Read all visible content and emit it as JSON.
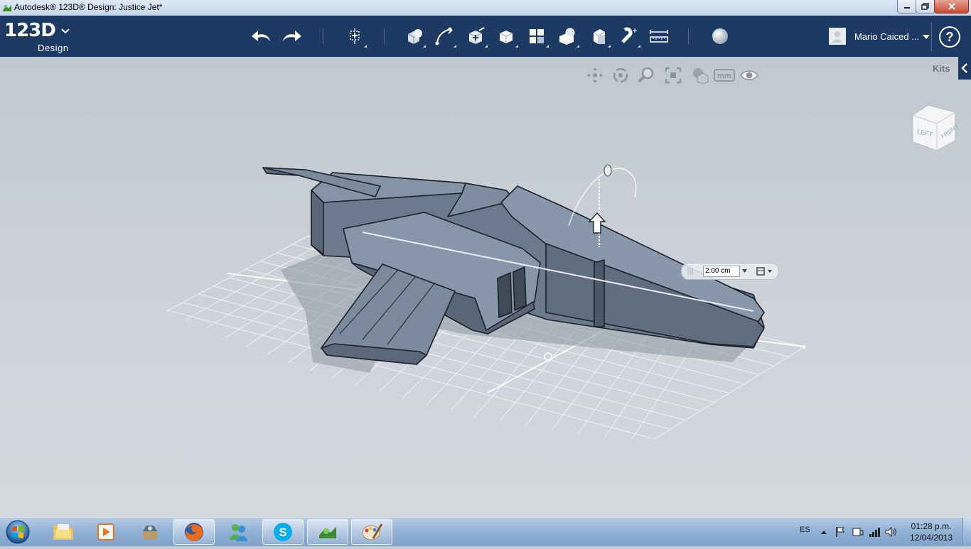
{
  "window": {
    "title": "Autodesk® 123D® Design: Justice Jet*",
    "minimize_icon": "minimize-icon",
    "maximize_icon": "maximize-icon",
    "close_icon": "close-icon"
  },
  "appbar": {
    "logo_main": "123D",
    "logo_sub": "Design",
    "logo_menu_icon": "chevron-down-icon",
    "toolbar": [
      {
        "name": "undo-button",
        "icon": "undo-icon"
      },
      {
        "name": "redo-button",
        "icon": "redo-icon"
      },
      {
        "name": "transform-button",
        "icon": "transform-icon"
      },
      {
        "name": "primitives-button",
        "icon": "primitives-icon"
      },
      {
        "name": "sketch-button",
        "icon": "sketch-icon"
      },
      {
        "name": "construct-button",
        "icon": "construct-icon"
      },
      {
        "name": "modify-button",
        "icon": "modify-icon"
      },
      {
        "name": "pattern-button",
        "icon": "pattern-icon"
      },
      {
        "name": "group-button",
        "icon": "group-icon"
      },
      {
        "name": "combine-button",
        "icon": "combine-icon"
      },
      {
        "name": "snap-button",
        "icon": "snap-icon"
      },
      {
        "name": "measure-button",
        "icon": "measure-icon"
      },
      {
        "name": "material-button",
        "icon": "material-sphere-icon"
      }
    ],
    "user_name": "Mario Caiced ...",
    "help_label": "?"
  },
  "viewport": {
    "nav_tools": [
      "pan-icon",
      "orbit-icon",
      "zoom-icon",
      "fit-icon",
      "view-style-icon",
      "units-icon",
      "visibility-icon"
    ],
    "units_label": "mm",
    "kits_label": "Kits",
    "viewcube": {
      "left": "LEFT",
      "front": "FRONT"
    },
    "dimension_value": "2.00 cm",
    "colors": {
      "model_fill": "#6b7a8c",
      "model_top": "#8493a5",
      "background": "#c5ccd3",
      "grid": "#ffffff"
    }
  },
  "taskbar": {
    "items": [
      {
        "name": "taskbar-explorer",
        "icon": "folder-icon"
      },
      {
        "name": "taskbar-media-player",
        "icon": "media-player-icon"
      },
      {
        "name": "taskbar-app-3",
        "icon": "box-app-icon"
      },
      {
        "name": "taskbar-firefox",
        "icon": "firefox-icon"
      },
      {
        "name": "taskbar-messenger",
        "icon": "messenger-icon"
      },
      {
        "name": "taskbar-skype",
        "icon": "skype-icon"
      },
      {
        "name": "taskbar-123d",
        "icon": "123d-icon"
      },
      {
        "name": "taskbar-paint",
        "icon": "paint-icon"
      }
    ],
    "language": "ES",
    "time": "01:28 p.m.",
    "date": "12/04/2013"
  }
}
